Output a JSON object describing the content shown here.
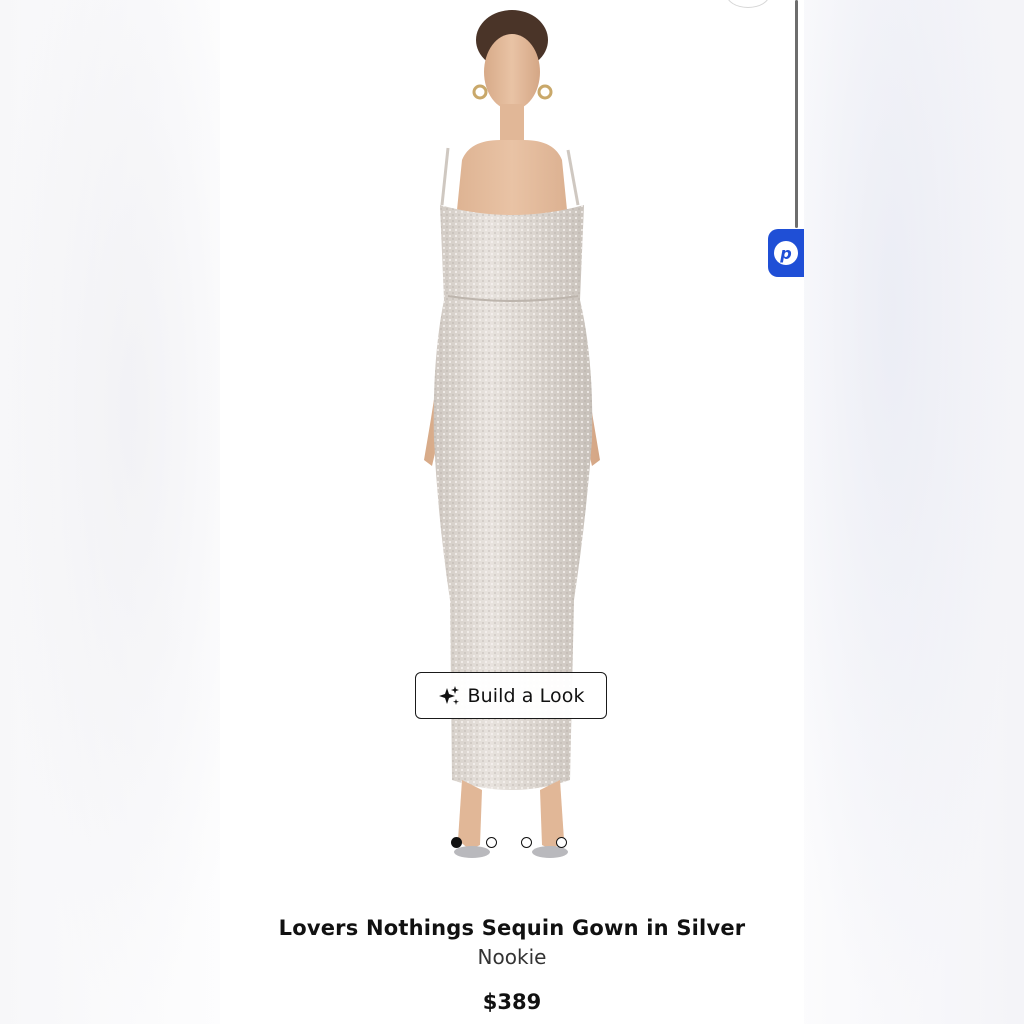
{
  "product": {
    "title": "Lovers Nothings Sequin Gown in Silver",
    "brand": "Nookie",
    "price": "$389"
  },
  "gallery": {
    "build_look_label": "Build a Look",
    "build_look_icon": "sparkles-icon",
    "slide_count": 4,
    "active_slide": 1
  },
  "widgets": {
    "badge_letter": "p",
    "badge_color": "#1f4fd6"
  },
  "colors": {
    "gown": "#d9d3cd",
    "skin": "#e2b99a",
    "text": "#111111"
  }
}
